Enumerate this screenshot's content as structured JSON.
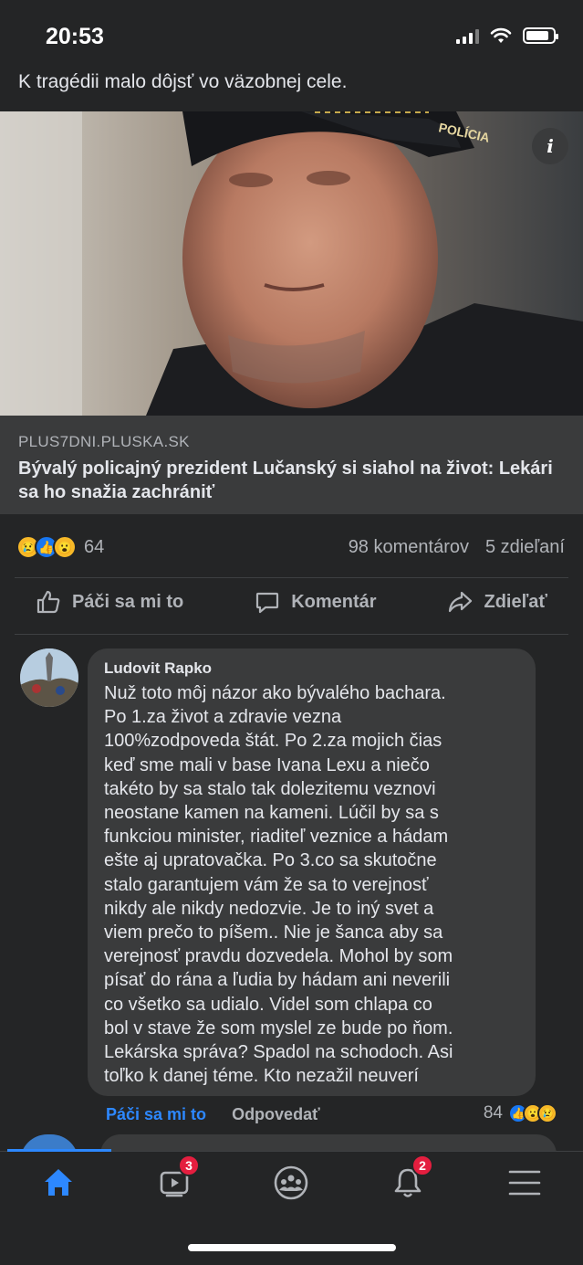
{
  "status_bar": {
    "time": "20:53"
  },
  "post": {
    "text": "K tragédii malo dôjsť vo väzobnej cele.",
    "link": {
      "domain": "PLUS7DNI.PLUSKA.SK",
      "title": "Bývalý policajný prezident Lučanský si siahol na život: Lekári sa ho snažia zachrániť"
    },
    "reactions": {
      "icons": [
        "sad-reaction",
        "like-reaction",
        "wow-reaction"
      ],
      "count": "64"
    },
    "comments_count": "98 komentárov",
    "shares_count": "5 zdieľaní",
    "actions": {
      "like": "Páči sa mi to",
      "comment": "Komentár",
      "share": "Zdieľať"
    }
  },
  "comment": {
    "author": "Ludovit Rapko",
    "text": "Nuž toto môj názor ako bývalého bachara.\nPo 1.za život a zdravie vezna\n100%zodpoveda štát. Po 2.za mojich čias\nkeď sme mali v base Ivana Lexu a niečo\ntakéto by sa stalo tak dolezitemu veznovi\nneostane kamen na kameni. Lúčil by sa s\nfunkciou minister, riaditeľ veznice a hádam\nešte aj upratovačka. Po 3.co sa skutočne\nstalo garantujem vám že sa to verejnosť\nnikdy ale nikdy nedozvie. Je to iný svet a\nviem prečo to píšem.. Nie je šanca aby sa\nverejnosť pravdu dozvedela. Mohol by som\npísať do rána a ľudia by hádam ani neverili\nco všetko sa udialo. Videl som chlapa co\nbol v stave že som myslel ze bude po ňom.\nLekárska správa? Spadol na schodoch. Asi\ntoľko k danej téme. Kto nezažil neuverí",
    "like_label": "Páči sa mi to",
    "reply_label": "Odpovedať",
    "reaction_count": "84",
    "reaction_icons": [
      "like-reaction",
      "wow-reaction",
      "sad-reaction"
    ]
  },
  "bottom_nav": {
    "items": [
      "home-icon",
      "watch-icon",
      "groups-icon",
      "notifications-icon",
      "menu-icon"
    ],
    "watch_badge": "3",
    "notifications_badge": "2"
  },
  "colors": {
    "background": "#242526",
    "surface": "#3a3b3c",
    "accent": "#2d88ff",
    "badge": "#e41e3f"
  }
}
